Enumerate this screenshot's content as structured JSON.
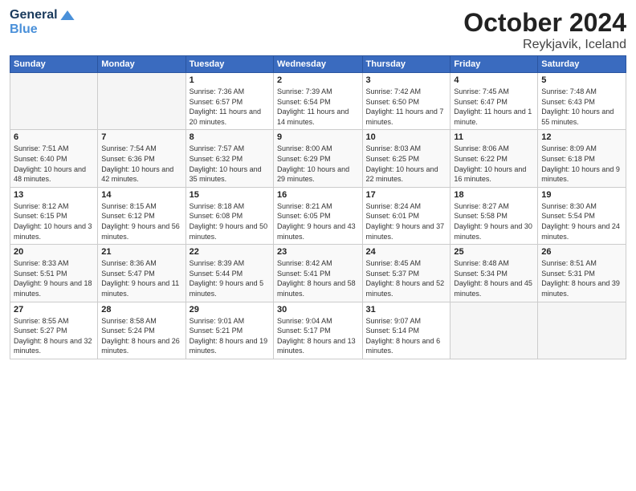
{
  "header": {
    "logo_general": "General",
    "logo_blue": "Blue",
    "month_title": "October 2024",
    "location": "Reykjavik, Iceland"
  },
  "weekdays": [
    "Sunday",
    "Monday",
    "Tuesday",
    "Wednesday",
    "Thursday",
    "Friday",
    "Saturday"
  ],
  "weeks": [
    [
      {
        "day": "",
        "sunrise": "",
        "sunset": "",
        "daylight": ""
      },
      {
        "day": "",
        "sunrise": "",
        "sunset": "",
        "daylight": ""
      },
      {
        "day": "1",
        "sunrise": "Sunrise: 7:36 AM",
        "sunset": "Sunset: 6:57 PM",
        "daylight": "Daylight: 11 hours and 20 minutes."
      },
      {
        "day": "2",
        "sunrise": "Sunrise: 7:39 AM",
        "sunset": "Sunset: 6:54 PM",
        "daylight": "Daylight: 11 hours and 14 minutes."
      },
      {
        "day": "3",
        "sunrise": "Sunrise: 7:42 AM",
        "sunset": "Sunset: 6:50 PM",
        "daylight": "Daylight: 11 hours and 7 minutes."
      },
      {
        "day": "4",
        "sunrise": "Sunrise: 7:45 AM",
        "sunset": "Sunset: 6:47 PM",
        "daylight": "Daylight: 11 hours and 1 minute."
      },
      {
        "day": "5",
        "sunrise": "Sunrise: 7:48 AM",
        "sunset": "Sunset: 6:43 PM",
        "daylight": "Daylight: 10 hours and 55 minutes."
      }
    ],
    [
      {
        "day": "6",
        "sunrise": "Sunrise: 7:51 AM",
        "sunset": "Sunset: 6:40 PM",
        "daylight": "Daylight: 10 hours and 48 minutes."
      },
      {
        "day": "7",
        "sunrise": "Sunrise: 7:54 AM",
        "sunset": "Sunset: 6:36 PM",
        "daylight": "Daylight: 10 hours and 42 minutes."
      },
      {
        "day": "8",
        "sunrise": "Sunrise: 7:57 AM",
        "sunset": "Sunset: 6:32 PM",
        "daylight": "Daylight: 10 hours and 35 minutes."
      },
      {
        "day": "9",
        "sunrise": "Sunrise: 8:00 AM",
        "sunset": "Sunset: 6:29 PM",
        "daylight": "Daylight: 10 hours and 29 minutes."
      },
      {
        "day": "10",
        "sunrise": "Sunrise: 8:03 AM",
        "sunset": "Sunset: 6:25 PM",
        "daylight": "Daylight: 10 hours and 22 minutes."
      },
      {
        "day": "11",
        "sunrise": "Sunrise: 8:06 AM",
        "sunset": "Sunset: 6:22 PM",
        "daylight": "Daylight: 10 hours and 16 minutes."
      },
      {
        "day": "12",
        "sunrise": "Sunrise: 8:09 AM",
        "sunset": "Sunset: 6:18 PM",
        "daylight": "Daylight: 10 hours and 9 minutes."
      }
    ],
    [
      {
        "day": "13",
        "sunrise": "Sunrise: 8:12 AM",
        "sunset": "Sunset: 6:15 PM",
        "daylight": "Daylight: 10 hours and 3 minutes."
      },
      {
        "day": "14",
        "sunrise": "Sunrise: 8:15 AM",
        "sunset": "Sunset: 6:12 PM",
        "daylight": "Daylight: 9 hours and 56 minutes."
      },
      {
        "day": "15",
        "sunrise": "Sunrise: 8:18 AM",
        "sunset": "Sunset: 6:08 PM",
        "daylight": "Daylight: 9 hours and 50 minutes."
      },
      {
        "day": "16",
        "sunrise": "Sunrise: 8:21 AM",
        "sunset": "Sunset: 6:05 PM",
        "daylight": "Daylight: 9 hours and 43 minutes."
      },
      {
        "day": "17",
        "sunrise": "Sunrise: 8:24 AM",
        "sunset": "Sunset: 6:01 PM",
        "daylight": "Daylight: 9 hours and 37 minutes."
      },
      {
        "day": "18",
        "sunrise": "Sunrise: 8:27 AM",
        "sunset": "Sunset: 5:58 PM",
        "daylight": "Daylight: 9 hours and 30 minutes."
      },
      {
        "day": "19",
        "sunrise": "Sunrise: 8:30 AM",
        "sunset": "Sunset: 5:54 PM",
        "daylight": "Daylight: 9 hours and 24 minutes."
      }
    ],
    [
      {
        "day": "20",
        "sunrise": "Sunrise: 8:33 AM",
        "sunset": "Sunset: 5:51 PM",
        "daylight": "Daylight: 9 hours and 18 minutes."
      },
      {
        "day": "21",
        "sunrise": "Sunrise: 8:36 AM",
        "sunset": "Sunset: 5:47 PM",
        "daylight": "Daylight: 9 hours and 11 minutes."
      },
      {
        "day": "22",
        "sunrise": "Sunrise: 8:39 AM",
        "sunset": "Sunset: 5:44 PM",
        "daylight": "Daylight: 9 hours and 5 minutes."
      },
      {
        "day": "23",
        "sunrise": "Sunrise: 8:42 AM",
        "sunset": "Sunset: 5:41 PM",
        "daylight": "Daylight: 8 hours and 58 minutes."
      },
      {
        "day": "24",
        "sunrise": "Sunrise: 8:45 AM",
        "sunset": "Sunset: 5:37 PM",
        "daylight": "Daylight: 8 hours and 52 minutes."
      },
      {
        "day": "25",
        "sunrise": "Sunrise: 8:48 AM",
        "sunset": "Sunset: 5:34 PM",
        "daylight": "Daylight: 8 hours and 45 minutes."
      },
      {
        "day": "26",
        "sunrise": "Sunrise: 8:51 AM",
        "sunset": "Sunset: 5:31 PM",
        "daylight": "Daylight: 8 hours and 39 minutes."
      }
    ],
    [
      {
        "day": "27",
        "sunrise": "Sunrise: 8:55 AM",
        "sunset": "Sunset: 5:27 PM",
        "daylight": "Daylight: 8 hours and 32 minutes."
      },
      {
        "day": "28",
        "sunrise": "Sunrise: 8:58 AM",
        "sunset": "Sunset: 5:24 PM",
        "daylight": "Daylight: 8 hours and 26 minutes."
      },
      {
        "day": "29",
        "sunrise": "Sunrise: 9:01 AM",
        "sunset": "Sunset: 5:21 PM",
        "daylight": "Daylight: 8 hours and 19 minutes."
      },
      {
        "day": "30",
        "sunrise": "Sunrise: 9:04 AM",
        "sunset": "Sunset: 5:17 PM",
        "daylight": "Daylight: 8 hours and 13 minutes."
      },
      {
        "day": "31",
        "sunrise": "Sunrise: 9:07 AM",
        "sunset": "Sunset: 5:14 PM",
        "daylight": "Daylight: 8 hours and 6 minutes."
      },
      {
        "day": "",
        "sunrise": "",
        "sunset": "",
        "daylight": ""
      },
      {
        "day": "",
        "sunrise": "",
        "sunset": "",
        "daylight": ""
      }
    ]
  ]
}
